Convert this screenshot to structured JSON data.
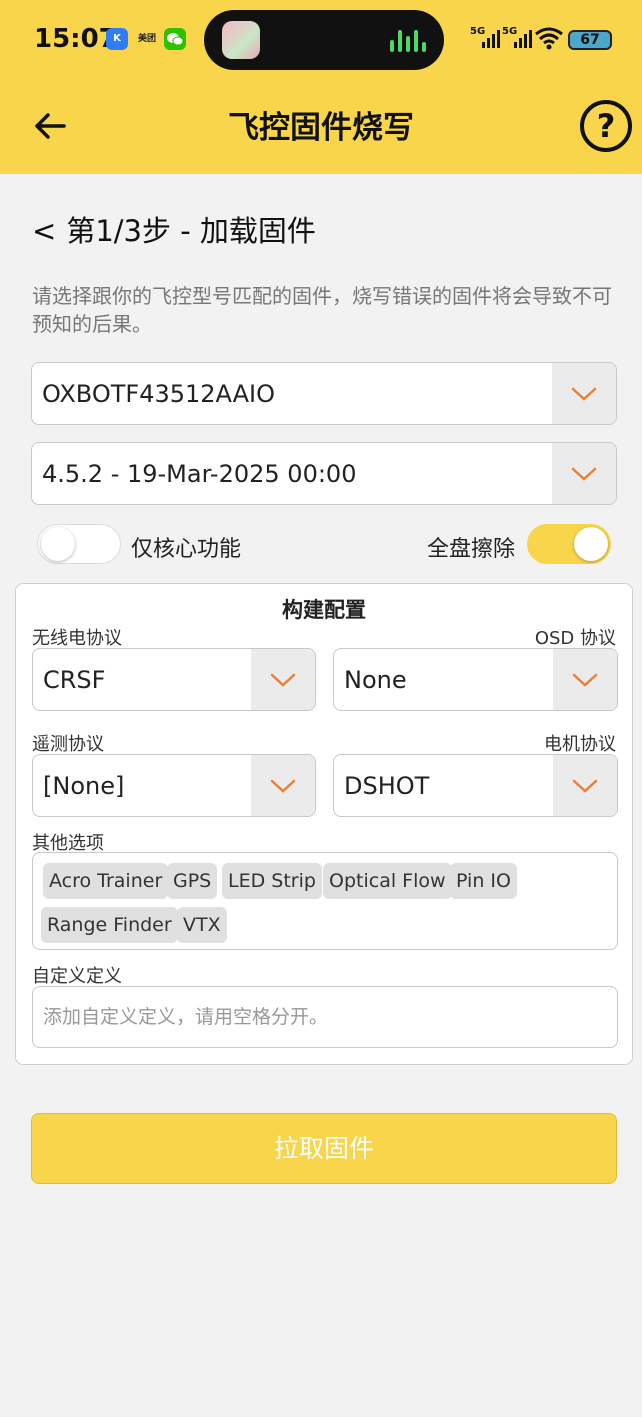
{
  "status_bar": {
    "time": "15:07",
    "app_icons": [
      "K",
      "美团",
      "wechat-icon"
    ],
    "signal1_label": "5G",
    "signal2_label": "5G",
    "battery": "67"
  },
  "app_bar": {
    "title": "飞控固件烧写",
    "help_label": "?"
  },
  "step": {
    "chevron": "<",
    "title": "第1/3步 - 加载固件"
  },
  "description": "请选择跟你的飞控型号匹配的固件，烧写错误的固件将会导致不可预知的后果。",
  "board_select": {
    "value": "OXBOTF43512AAIO"
  },
  "version_select": {
    "value": "4.5.2 - 19-Mar-2025 00:00"
  },
  "toggles": {
    "core_only": {
      "label": "仅核心功能",
      "on": false
    },
    "full_erase": {
      "label": "全盘擦除",
      "on": true
    }
  },
  "build_config": {
    "title": "构建配置",
    "radio_protocol": {
      "label": "无线电协议",
      "value": "CRSF"
    },
    "osd_protocol": {
      "label": "OSD 协议",
      "value": "None"
    },
    "telemetry_protocol": {
      "label": "遥测协议",
      "value": "[None]"
    },
    "motor_protocol": {
      "label": "电机协议",
      "value": "DSHOT"
    },
    "other_options": {
      "label": "其他选项",
      "chips": [
        "Acro Trainer",
        "GPS",
        "LED Strip",
        "Optical Flow",
        "Pin IO",
        "Range Finder",
        "VTX"
      ]
    },
    "custom_defines": {
      "label": "自定义定义",
      "placeholder": "添加自定义定义，请用空格分开。"
    }
  },
  "fetch_button": {
    "label": "拉取固件"
  },
  "colors": {
    "accent": "#f8d54a",
    "arrow": "#e8823a",
    "background": "#f2f2f2"
  }
}
